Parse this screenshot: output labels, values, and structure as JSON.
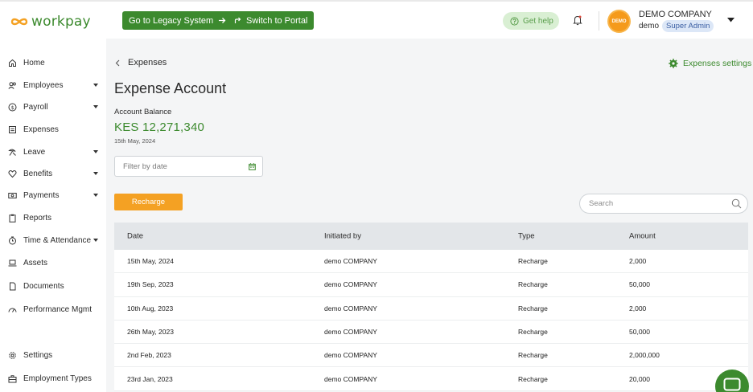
{
  "brand": {
    "name": "workpay",
    "color": "#3c8a2e"
  },
  "header": {
    "legacy_button": "Go to Legacy System",
    "portal_button": "Switch to Portal",
    "help_button": "Get help",
    "company_name": "DEMO COMPANY",
    "company_badge_text": "DEMO",
    "user_name": "demo",
    "user_role": "Super Admin"
  },
  "sidebar": {
    "items": [
      {
        "label": "Home",
        "icon": "home-icon",
        "has_dropdown": false
      },
      {
        "label": "Employees",
        "icon": "users-icon",
        "has_dropdown": true
      },
      {
        "label": "Payroll",
        "icon": "dollar-icon",
        "has_dropdown": true
      },
      {
        "label": "Expenses",
        "icon": "receipt-icon",
        "has_dropdown": false
      },
      {
        "label": "Leave",
        "icon": "beach-icon",
        "has_dropdown": true
      },
      {
        "label": "Benefits",
        "icon": "heart-icon",
        "has_dropdown": true
      },
      {
        "label": "Payments",
        "icon": "cash-icon",
        "has_dropdown": true
      },
      {
        "label": "Reports",
        "icon": "clipboard-icon",
        "has_dropdown": false
      },
      {
        "label": "Time & Attendance",
        "icon": "clock-icon",
        "has_dropdown": true
      },
      {
        "label": "Assets",
        "icon": "laptop-icon",
        "has_dropdown": false
      },
      {
        "label": "Documents",
        "icon": "document-icon",
        "has_dropdown": false
      },
      {
        "label": "Performance Mgmt",
        "icon": "gauge-icon",
        "has_dropdown": false
      },
      {
        "label": "Settings",
        "icon": "gear-icon",
        "has_dropdown": false
      },
      {
        "label": "Employment Types",
        "icon": "briefcase-icon",
        "has_dropdown": false
      }
    ]
  },
  "main": {
    "breadcrumb": "Expenses",
    "settings_link": "Expenses settings",
    "title": "Expense Account",
    "balance_label": "Account Balance",
    "balance_value": "KES 12,271,340",
    "balance_date": "15th May, 2024",
    "filter_placeholder": "Filter by date",
    "recharge_button": "Recharge",
    "search_placeholder": "Search",
    "table": {
      "columns": [
        "Date",
        "Initiated by",
        "Type",
        "Amount"
      ],
      "rows": [
        [
          "15th May, 2024",
          "demo COMPANY",
          "Recharge",
          "2,000"
        ],
        [
          "19th Sep, 2023",
          "demo COMPANY",
          "Recharge",
          "50,000"
        ],
        [
          "10th Aug, 2023",
          "demo COMPANY",
          "Recharge",
          "2,000"
        ],
        [
          "26th May, 2023",
          "demo COMPANY",
          "Recharge",
          "50,000"
        ],
        [
          "2nd Feb, 2023",
          "demo COMPANY",
          "Recharge",
          "2,000,000"
        ],
        [
          "23rd Jan, 2023",
          "demo COMPANY",
          "Recharge",
          "20,000"
        ]
      ]
    }
  },
  "colors": {
    "accent": "#3c8a2e",
    "recharge": "#f4a123",
    "table_header": "#e3e6e9"
  }
}
